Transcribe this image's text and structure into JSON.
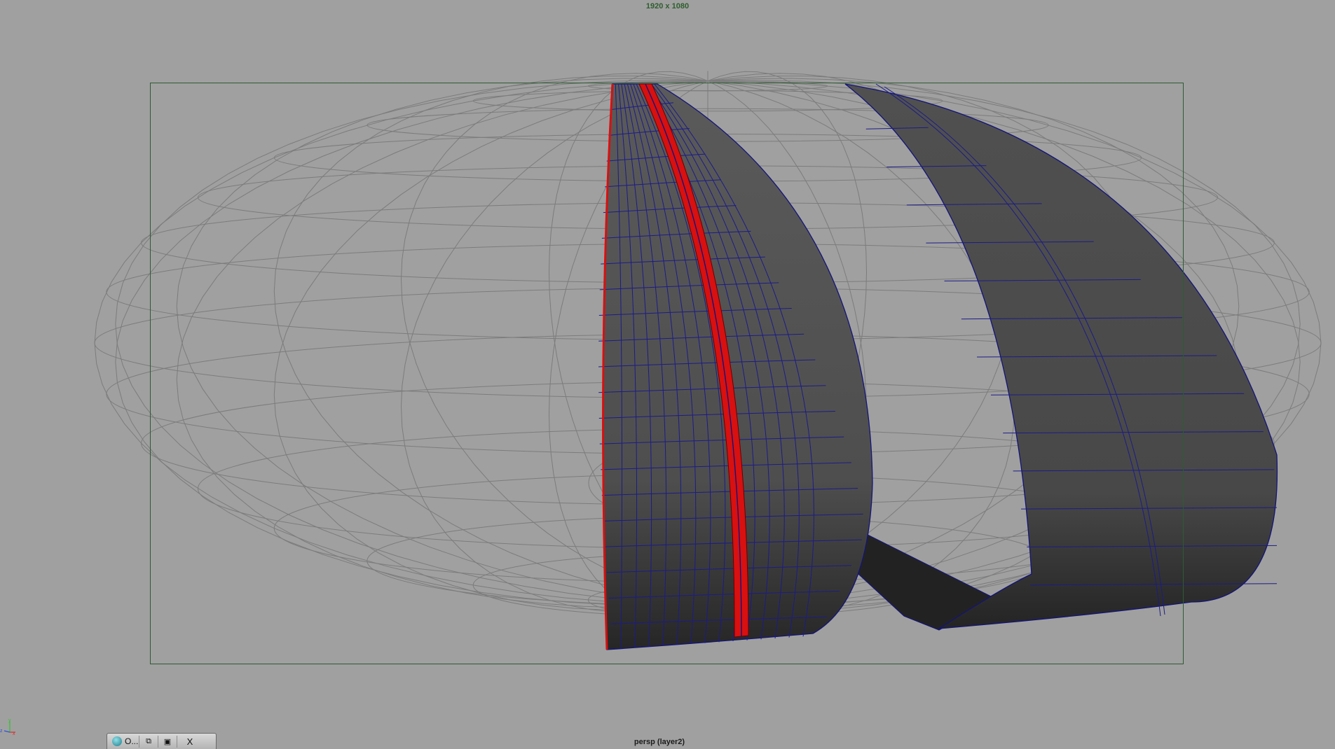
{
  "viewport": {
    "resolution_label": "1920 x 1080",
    "camera_label": "persp (layer2)"
  },
  "minibar": {
    "title": "O...",
    "app_icon": "maya-app-icon",
    "buttons": [
      "restore-icon",
      "maximize-icon",
      "close-icon"
    ],
    "restore_glyph": "⧉",
    "maximize_glyph": "▣",
    "close_glyph": "X"
  },
  "axis_gizmo": {
    "axes": [
      "x",
      "y",
      "z"
    ],
    "colors": {
      "x": "#d83030",
      "y": "#30c030",
      "z": "#3050d8"
    }
  },
  "colors": {
    "background": "#a0a0a0",
    "gate": "#2e5a34",
    "wireframe": "#7c7c7c",
    "shell_edges": "#14147a",
    "selected_faces": "#d81010"
  }
}
